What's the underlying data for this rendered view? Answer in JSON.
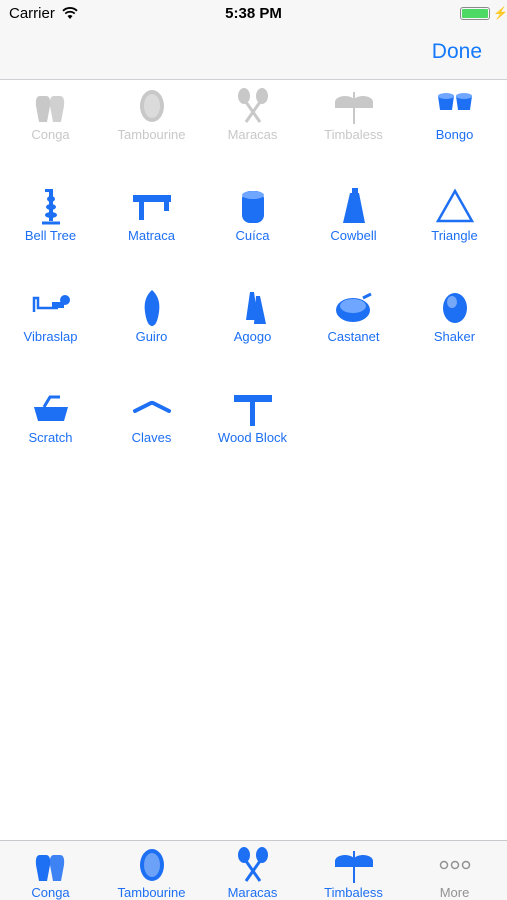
{
  "status_bar": {
    "carrier": "Carrier",
    "time": "5:38 PM",
    "battery_level": 1.0
  },
  "nav": {
    "done_label": "Done"
  },
  "colors": {
    "accent": "#1d6ff3",
    "faded": "#c8c8c8",
    "battery": "#4cd964"
  },
  "instruments": [
    {
      "label": "Conga",
      "icon": "conga-icon",
      "faded": true
    },
    {
      "label": "Tambourine",
      "icon": "tambourine-icon",
      "faded": true
    },
    {
      "label": "Maracas",
      "icon": "maracas-icon",
      "faded": true
    },
    {
      "label": "Timbaless",
      "icon": "timbales-icon",
      "faded": true
    },
    {
      "label": "Bongo",
      "icon": "bongo-icon",
      "faded": false
    },
    {
      "label": "Bell Tree",
      "icon": "bell-tree-icon",
      "faded": false
    },
    {
      "label": "Matraca",
      "icon": "matraca-icon",
      "faded": false
    },
    {
      "label": "Cuíca",
      "icon": "cuica-icon",
      "faded": false
    },
    {
      "label": "Cowbell",
      "icon": "cowbell-icon",
      "faded": false
    },
    {
      "label": "Triangle",
      "icon": "triangle-icon",
      "faded": false
    },
    {
      "label": "Vibraslap",
      "icon": "vibraslap-icon",
      "faded": false
    },
    {
      "label": "Guiro",
      "icon": "guiro-icon",
      "faded": false
    },
    {
      "label": "Agogo",
      "icon": "agogo-icon",
      "faded": false
    },
    {
      "label": "Castanet",
      "icon": "castanet-icon",
      "faded": false
    },
    {
      "label": "Shaker",
      "icon": "shaker-icon",
      "faded": false
    },
    {
      "label": "Scratch",
      "icon": "scratch-icon",
      "faded": false
    },
    {
      "label": "Claves",
      "icon": "claves-icon",
      "faded": false
    },
    {
      "label": "Wood Block",
      "icon": "wood-block-icon",
      "faded": false
    }
  ],
  "tab_bar": [
    {
      "label": "Conga",
      "icon": "conga-icon"
    },
    {
      "label": "Tambourine",
      "icon": "tambourine-icon"
    },
    {
      "label": "Maracas",
      "icon": "maracas-icon"
    },
    {
      "label": "Timbaless",
      "icon": "timbales-icon"
    },
    {
      "label": "More",
      "icon": "more-icon"
    }
  ]
}
